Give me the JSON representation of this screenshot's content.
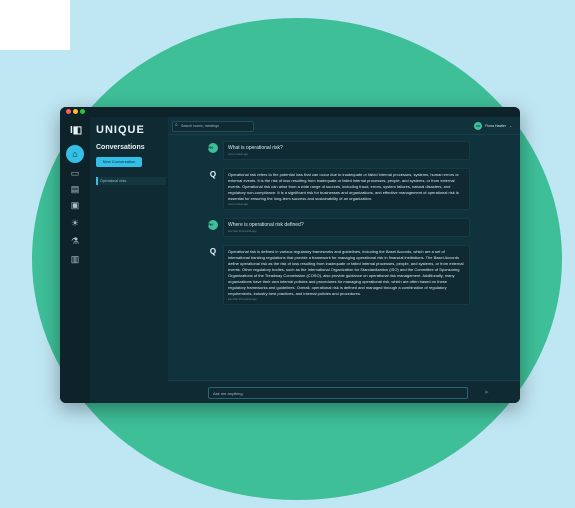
{
  "brand": "UNIQUE",
  "rail": {
    "logo": "I◧",
    "icons": [
      "⌂",
      "▭",
      "▤",
      "▣",
      "☀",
      "⚗",
      "▥"
    ]
  },
  "sidebar": {
    "title": "Conversations",
    "new_button": "New Conversation",
    "items": [
      {
        "label": "Operational risks"
      }
    ]
  },
  "topbar": {
    "search_placeholder": "Search rooms, meetings",
    "user_initials": "FH",
    "user_name": "Fiona Hastler",
    "user_chevron": "⌄"
  },
  "messages": [
    {
      "role": "user",
      "badge": "FH",
      "text": "What is operational risk?",
      "timestamp": "Just a minute ago"
    },
    {
      "role": "bot",
      "badge": "Q",
      "text": "Operational risk refers to the potential loss that can occur due to inadequate or failed internal processes, systems, human errors or external events. It is the risk of loss resulting from inadequate or failed internal processes, people, and systems, or from external events. Operational risk can arise from a wide range of sources, including fraud, errors, system failures, natural disasters, and regulatory non-compliance. It is a significant risk for businesses and organizations, and effective management of operational risk is essential for ensuring the long-term success and sustainability of an organization.",
      "timestamp": "Just a minute ago"
    },
    {
      "role": "user",
      "badge": "FH",
      "text": "Where is operational risk defined?",
      "timestamp": "less than 30 seconds ago"
    },
    {
      "role": "bot",
      "badge": "Q",
      "text": "Operational risk is defined in various regulatory frameworks and guidelines, including the Basel Accords, which are a set of international banking regulations that provide a framework for managing operational risk in financial institutions. The Basel Accords define operational risk as the risk of loss resulting from inadequate or failed internal processes, people, and systems, or from external events. Other regulatory bodies, such as the International Organization for Standardization (ISO) and the Committee of Sponsoring Organizations of the Treadway Commission (COSO), also provide guidance on operational risk management. Additionally, many organizations have their own internal policies and procedures for managing operational risk, which are often based on these regulatory frameworks and guidelines. Overall, operational risk is defined and managed through a combination of regulatory requirements, industry best practices, and internal policies and procedures.",
      "timestamp": "less than 30 seconds ago"
    }
  ],
  "composer": {
    "placeholder": "Ask me anything",
    "send_icon": "➤"
  },
  "colors": {
    "accent": "#34bfe6",
    "green": "#3ebf98",
    "bg": "#0f2a33"
  }
}
